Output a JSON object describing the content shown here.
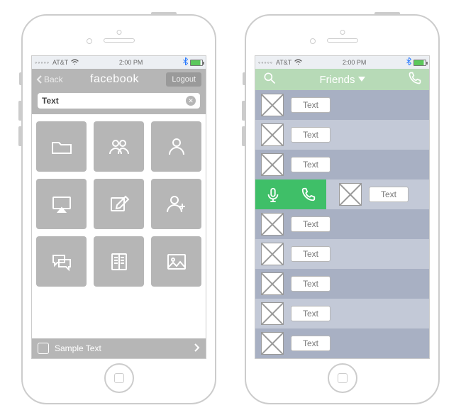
{
  "status": {
    "signal": "◦◦◦◦◦",
    "carrier": "AT&T",
    "time": "2:00 PM"
  },
  "phoneA": {
    "back": "Back",
    "title": "facebook",
    "logout": "Logout",
    "search_value": "Text",
    "tiles": [
      "folder",
      "group",
      "person",
      "image-down",
      "compose",
      "add-person",
      "chat",
      "book",
      "picture"
    ],
    "footer": "Sample Text"
  },
  "phoneB": {
    "title": "Friends",
    "rows": [
      {
        "label": "Text"
      },
      {
        "label": "Text"
      },
      {
        "label": "Text"
      },
      {
        "label": "Text",
        "swiped": true
      },
      {
        "label": "Text"
      },
      {
        "label": "Text"
      },
      {
        "label": "Text"
      },
      {
        "label": "Text"
      },
      {
        "label": "Text"
      }
    ]
  }
}
